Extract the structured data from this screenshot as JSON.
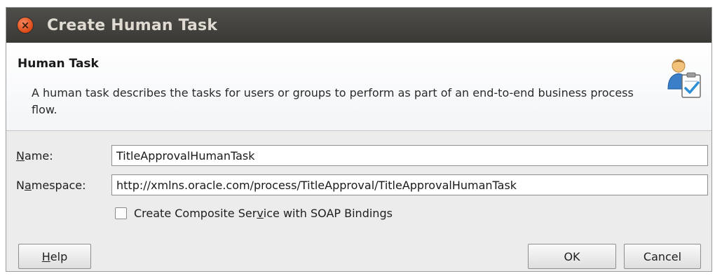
{
  "window": {
    "title": "Create Human Task",
    "close_glyph": "×"
  },
  "header": {
    "title": "Human Task",
    "description": "A human task describes the tasks for users or groups to perform as part of an end-to-end business process flow.",
    "icon": "user-task-icon"
  },
  "form": {
    "name_label_prefix": "",
    "name_label_mnemonic": "N",
    "name_label_suffix": "ame:",
    "name_value": "TitleApprovalHumanTask",
    "namespace_label_prefix": "N",
    "namespace_label_mnemonic": "a",
    "namespace_label_suffix": "mespace:",
    "namespace_value": "http://xmlns.oracle.com/process/TitleApproval/TitleApprovalHumanTask",
    "checkbox_label_prefix": "Create Composite Ser",
    "checkbox_label_mnemonic": "v",
    "checkbox_label_suffix": "ice with SOAP Bindings",
    "checkbox_checked": false
  },
  "buttons": {
    "help_mnemonic": "H",
    "help_suffix": "elp",
    "ok_label": "OK",
    "cancel_label": "Cancel"
  },
  "colors": {
    "titlebar": "#3a3935",
    "close_button": "#dd4814",
    "dialog_bg": "#ececec"
  }
}
